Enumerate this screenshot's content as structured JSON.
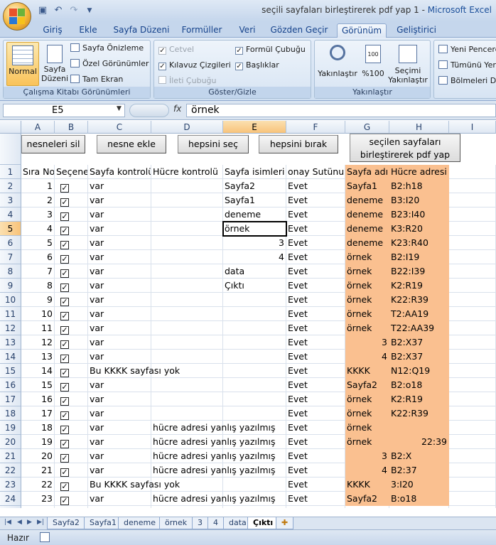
{
  "window": {
    "doc_title": "seçili sayfaları birleştirerek pdf yap 1",
    "separator": " - ",
    "app_name": "Microsoft Excel"
  },
  "ribbon_tabs": [
    "Giriş",
    "Ekle",
    "Sayfa Düzeni",
    "Formüller",
    "Veri",
    "Gözden Geçir",
    "Görünüm",
    "Geliştirici"
  ],
  "active_tab": "Görünüm",
  "ribbon": {
    "views": {
      "normal": "Normal",
      "page_layout_1": "Sayfa",
      "page_layout_2": "Düzeni",
      "page_break": "Sayfa Önizleme",
      "custom": "Özel Görünümler",
      "full": "Tam Ekran",
      "label": "Çalışma Kitabı Görünümleri"
    },
    "show": {
      "ruler": "Cetvel",
      "gridlines": "Kılavuz Çizgileri",
      "message_bar": "İleti Çubuğu",
      "formula_bar": "Formül Çubuğu",
      "headings": "Başlıklar",
      "label": "Göster/Gizle"
    },
    "zoom": {
      "zoom": "Yakınlaştır",
      "hundred": "%100",
      "selection_1": "Seçimi",
      "selection_2": "Yakınlaştır",
      "label": "Yakınlaştır"
    },
    "window": {
      "new_window": "Yeni Pencere",
      "arrange": "Tümünü Yerl",
      "split": "Bölmeleri Do"
    }
  },
  "formula_bar": {
    "name_box": "E5",
    "fx": "fx",
    "value": "örnek"
  },
  "columns": [
    "A",
    "B",
    "C",
    "D",
    "E",
    "F",
    "G",
    "H",
    "I"
  ],
  "buttons": {
    "delete_objects": "nesneleri sil",
    "add_object": "nesne ekle",
    "select_all": "hepsini seç",
    "deselect_all": "hepsini bırak",
    "merge_pdf_1": "seçilen sayfaları",
    "merge_pdf_2": "birleştirerek pdf yap"
  },
  "headers": {
    "A": "Sıra No",
    "B": "Seçenek",
    "C": "Sayfa kontrolü",
    "D": "Hücre kontrolü",
    "E": "Sayfa isimleri",
    "F": "onay Sutünu",
    "G": "Sayfa adı",
    "H": "Hücre adresi"
  },
  "rows": [
    {
      "r": "2",
      "a": "1",
      "c": "var",
      "d": "",
      "e": "Sayfa2",
      "f": "Evet",
      "g": "Sayfa1",
      "h": "B2:h18"
    },
    {
      "r": "3",
      "a": "2",
      "c": "var",
      "d": "",
      "e": "Sayfa1",
      "f": "Evet",
      "g": "deneme",
      "h": "B3:I20"
    },
    {
      "r": "4",
      "a": "3",
      "c": "var",
      "d": "",
      "e": "deneme",
      "f": "Evet",
      "g": "deneme",
      "h": "B23:I40"
    },
    {
      "r": "5",
      "a": "4",
      "c": "var",
      "d": "",
      "e": "örnek",
      "f": "Evet",
      "g": "deneme",
      "h": "K3:R20"
    },
    {
      "r": "6",
      "a": "5",
      "c": "var",
      "d": "",
      "e": "3",
      "f": "Evet",
      "g": "deneme",
      "h": "K23:R40"
    },
    {
      "r": "7",
      "a": "6",
      "c": "var",
      "d": "",
      "e": "4",
      "f": "Evet",
      "g": "örnek",
      "h": "B2:I19"
    },
    {
      "r": "8",
      "a": "7",
      "c": "var",
      "d": "",
      "e": "data",
      "f": "Evet",
      "g": "örnek",
      "h": "B22:I39"
    },
    {
      "r": "9",
      "a": "8",
      "c": "var",
      "d": "",
      "e": "Çıktı",
      "f": "Evet",
      "g": "örnek",
      "h": "K2:R19"
    },
    {
      "r": "10",
      "a": "9",
      "c": "var",
      "d": "",
      "e": "",
      "f": "Evet",
      "g": "örnek",
      "h": "K22:R39"
    },
    {
      "r": "11",
      "a": "10",
      "c": "var",
      "d": "",
      "e": "",
      "f": "Evet",
      "g": "örnek",
      "h": "T2:AA19"
    },
    {
      "r": "12",
      "a": "11",
      "c": "var",
      "d": "",
      "e": "",
      "f": "Evet",
      "g": "örnek",
      "h": "T22:AA39"
    },
    {
      "r": "13",
      "a": "12",
      "c": "var",
      "d": "",
      "e": "",
      "f": "Evet",
      "g": "3",
      "h": "B2:X37"
    },
    {
      "r": "14",
      "a": "13",
      "c": "var",
      "d": "",
      "e": "",
      "f": "Evet",
      "g": "4",
      "h": "B2:X37"
    },
    {
      "r": "15",
      "a": "14",
      "c": "Bu KKKK sayfası yok",
      "d": "",
      "e": "",
      "f": "Evet",
      "g": "KKKK",
      "h": "N12:Q19"
    },
    {
      "r": "16",
      "a": "15",
      "c": "var",
      "d": "",
      "e": "",
      "f": "Evet",
      "g": "Sayfa2",
      "h": "B2:o18"
    },
    {
      "r": "17",
      "a": "16",
      "c": "var",
      "d": "",
      "e": "",
      "f": "Evet",
      "g": "örnek",
      "h": "K2:R19"
    },
    {
      "r": "18",
      "a": "17",
      "c": "var",
      "d": "",
      "e": "",
      "f": "Evet",
      "g": "örnek",
      "h": "K22:R39"
    },
    {
      "r": "19",
      "a": "18",
      "c": "var",
      "d": "hücre adresi yanlış yazılmış",
      "e": "",
      "f": "Evet",
      "g": "örnek",
      "h": ""
    },
    {
      "r": "20",
      "a": "19",
      "c": "var",
      "d": "hücre adresi yanlış yazılmış",
      "e": "",
      "f": "Evet",
      "g": "örnek",
      "h": "22:39"
    },
    {
      "r": "21",
      "a": "20",
      "c": "var",
      "d": "hücre adresi yanlış yazılmış",
      "e": "",
      "f": "Evet",
      "g": "3",
      "h": "B2:X"
    },
    {
      "r": "22",
      "a": "21",
      "c": "var",
      "d": "hücre adresi yanlış yazılmış",
      "e": "",
      "f": "Evet",
      "g": "4",
      "h": "B2:37"
    },
    {
      "r": "23",
      "a": "22",
      "c": "Bu KKKK sayfası yok",
      "d": "",
      "e": "",
      "f": "Evet",
      "g": "KKKK",
      "h": "3:I20"
    },
    {
      "r": "24",
      "a": "23",
      "c": "var",
      "d": "hücre adresi yanlış yazılmış",
      "e": "",
      "f": "Evet",
      "g": "Sayfa2",
      "h": "B:o18"
    }
  ],
  "last_row_num": "25",
  "header_row_num": "1",
  "sheet_tabs": [
    "Sayfa2",
    "Sayfa1",
    "deneme",
    "örnek",
    "3",
    "4",
    "data",
    "Çıktı"
  ],
  "active_sheet": "Çıktı",
  "status": "Hazır",
  "colors": {
    "orange": "#fac090",
    "selection": "#f8c37a"
  }
}
